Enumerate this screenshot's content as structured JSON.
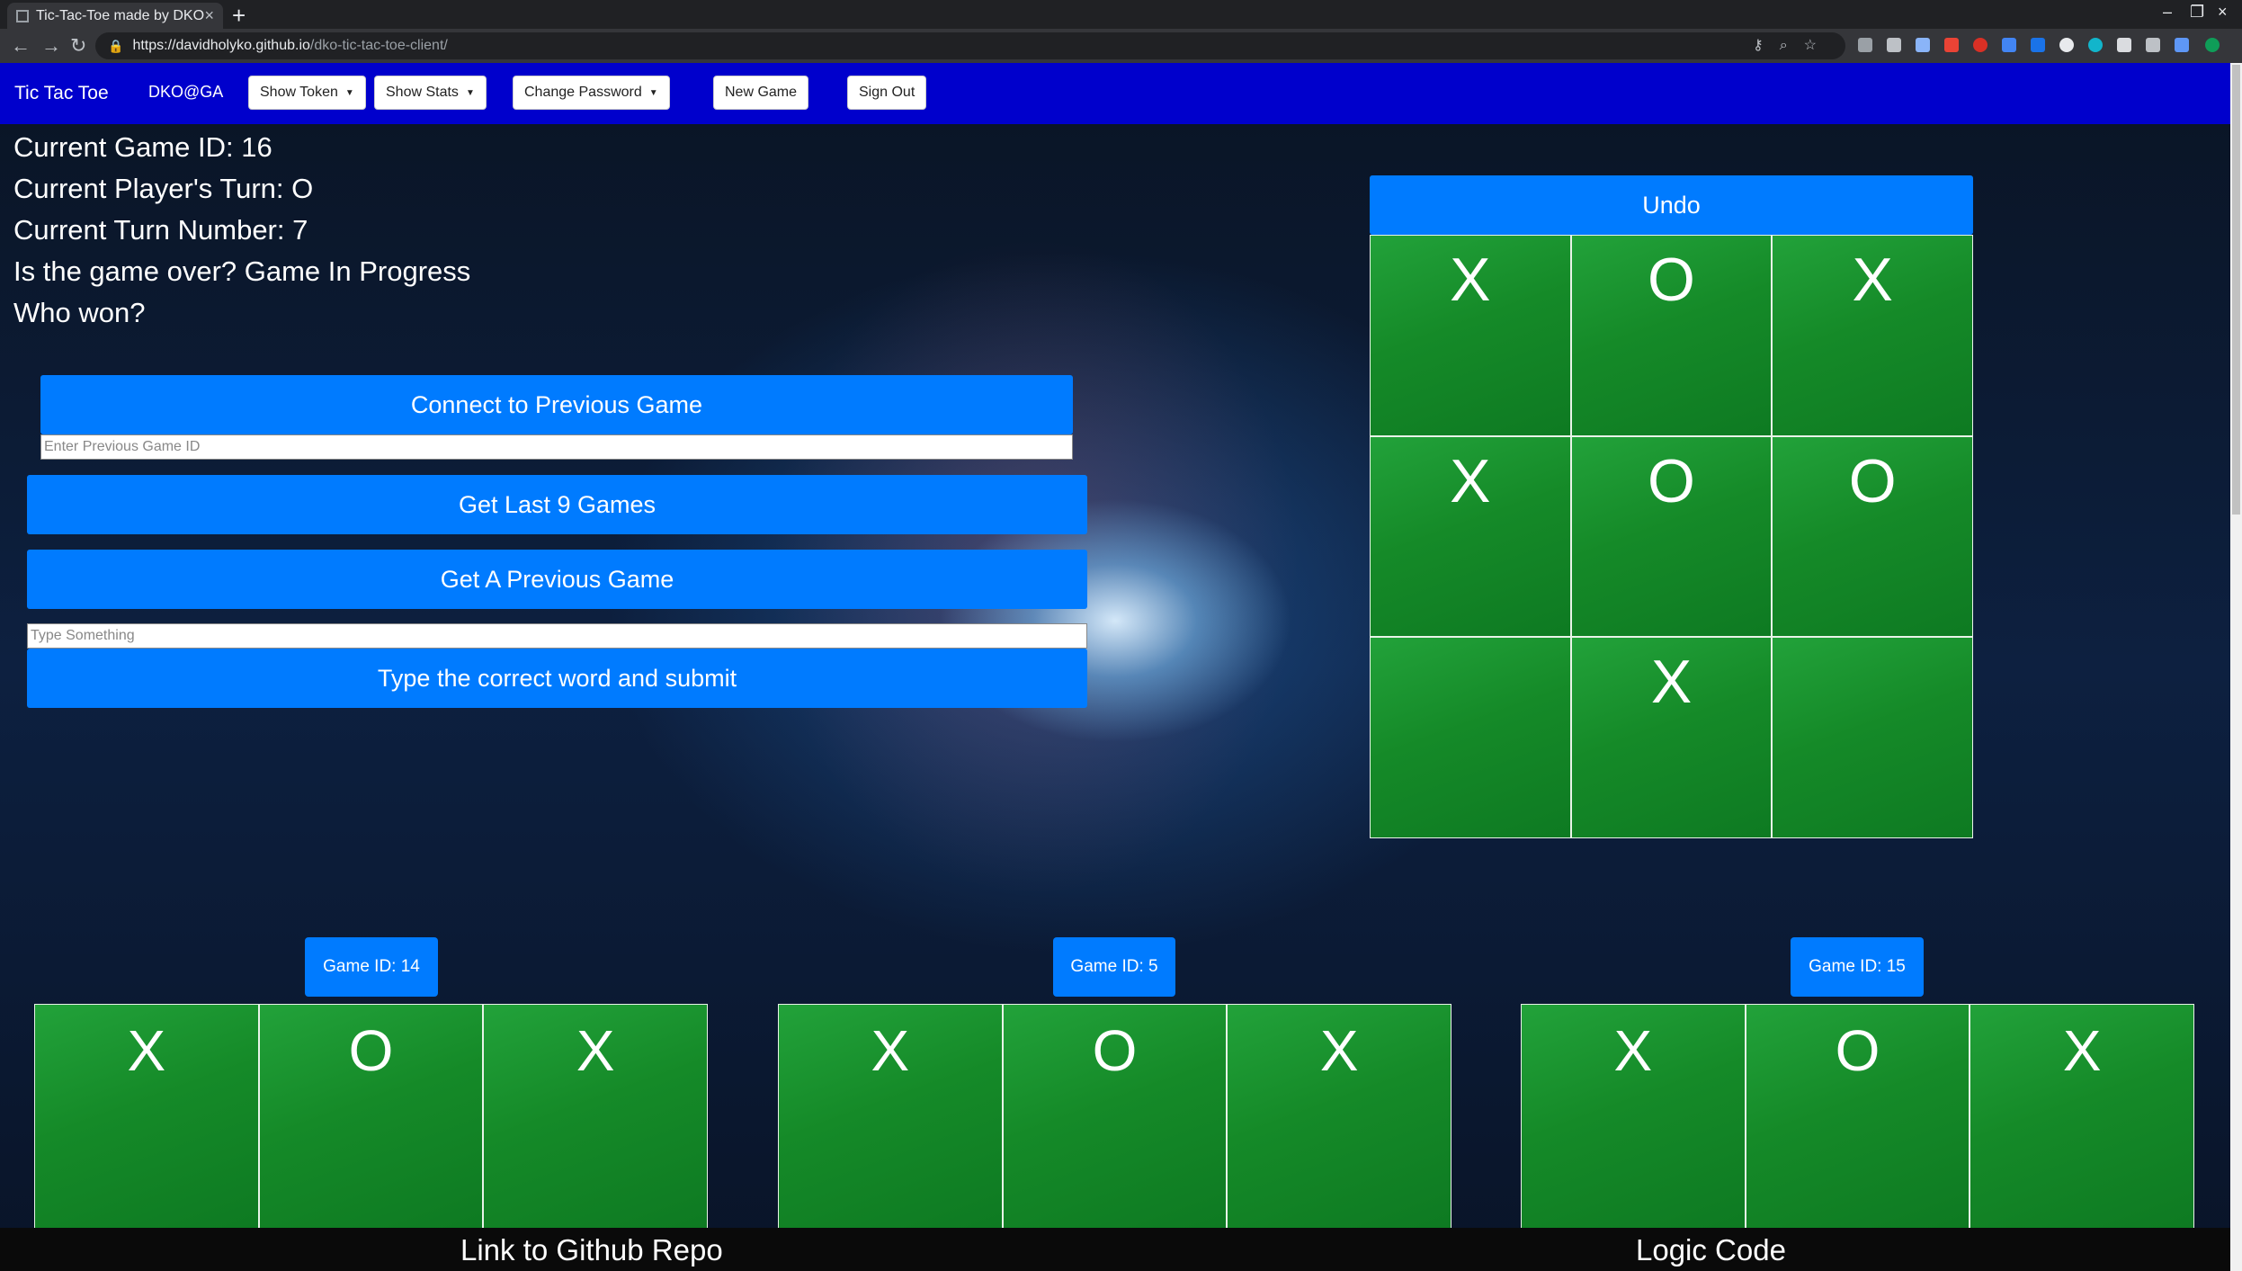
{
  "browser": {
    "tab_title": "Tic-Tac-Toe made by DKO",
    "tab_close": "×",
    "new_tab": "+",
    "url_host": "https://davidholyko.github.io",
    "url_path": "/dko-tic-tac-toe-client/",
    "window_controls": [
      "–",
      "❐",
      "×"
    ]
  },
  "navbar": {
    "brand": "Tic Tac Toe",
    "user": "DKO@GA",
    "show_token": "Show Token",
    "show_stats": "Show Stats",
    "change_password": "Change Password",
    "new_game": "New Game",
    "sign_out": "Sign Out"
  },
  "status": {
    "game_id": "Current Game ID: 16",
    "player_turn": "Current Player's Turn: O",
    "turn_number": "Current Turn Number: 7",
    "game_over": "Is the game over? Game In Progress",
    "who_won": "Who won?"
  },
  "controls": {
    "connect_label": "Connect to Previous Game",
    "previous_id_placeholder": "Enter Previous Game ID",
    "last9_label": "Get Last 9 Games",
    "get_previous_label": "Get A Previous Game",
    "type_placeholder": "Type Something",
    "submit_label": "Type the correct word and submit"
  },
  "main_board": {
    "undo_label": "Undo",
    "cells": [
      "X",
      "O",
      "X",
      "X",
      "O",
      "O",
      "",
      "X",
      ""
    ]
  },
  "previous_games": [
    {
      "label": "Game ID: 14",
      "cells": [
        "X",
        "O",
        "X"
      ]
    },
    {
      "label": "Game ID: 5",
      "cells": [
        "X",
        "O",
        "X"
      ]
    },
    {
      "label": "Game ID: 15",
      "cells": [
        "X",
        "O",
        "X"
      ]
    }
  ],
  "footer": {
    "github_link": "Link to Github Repo",
    "logic_link": "Logic Code"
  },
  "colors": {
    "navbar": "#0000cc",
    "button_blue": "#007bff",
    "board_green": "#1d8f2d"
  }
}
